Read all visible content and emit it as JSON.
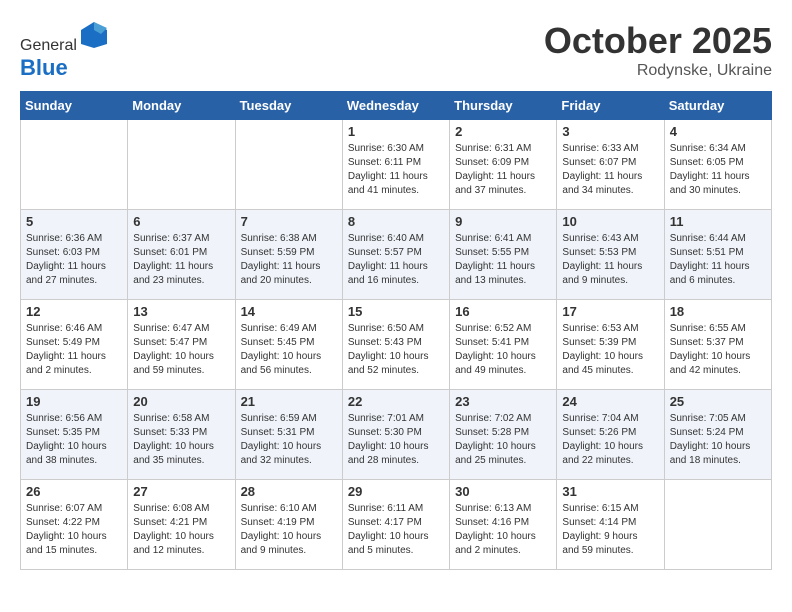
{
  "header": {
    "logo_general": "General",
    "logo_blue": "Blue",
    "month": "October 2025",
    "location": "Rodynske, Ukraine"
  },
  "weekdays": [
    "Sunday",
    "Monday",
    "Tuesday",
    "Wednesday",
    "Thursday",
    "Friday",
    "Saturday"
  ],
  "weeks": [
    [
      {
        "day": "",
        "info": ""
      },
      {
        "day": "",
        "info": ""
      },
      {
        "day": "",
        "info": ""
      },
      {
        "day": "1",
        "info": "Sunrise: 6:30 AM\nSunset: 6:11 PM\nDaylight: 11 hours\nand 41 minutes."
      },
      {
        "day": "2",
        "info": "Sunrise: 6:31 AM\nSunset: 6:09 PM\nDaylight: 11 hours\nand 37 minutes."
      },
      {
        "day": "3",
        "info": "Sunrise: 6:33 AM\nSunset: 6:07 PM\nDaylight: 11 hours\nand 34 minutes."
      },
      {
        "day": "4",
        "info": "Sunrise: 6:34 AM\nSunset: 6:05 PM\nDaylight: 11 hours\nand 30 minutes."
      }
    ],
    [
      {
        "day": "5",
        "info": "Sunrise: 6:36 AM\nSunset: 6:03 PM\nDaylight: 11 hours\nand 27 minutes."
      },
      {
        "day": "6",
        "info": "Sunrise: 6:37 AM\nSunset: 6:01 PM\nDaylight: 11 hours\nand 23 minutes."
      },
      {
        "day": "7",
        "info": "Sunrise: 6:38 AM\nSunset: 5:59 PM\nDaylight: 11 hours\nand 20 minutes."
      },
      {
        "day": "8",
        "info": "Sunrise: 6:40 AM\nSunset: 5:57 PM\nDaylight: 11 hours\nand 16 minutes."
      },
      {
        "day": "9",
        "info": "Sunrise: 6:41 AM\nSunset: 5:55 PM\nDaylight: 11 hours\nand 13 minutes."
      },
      {
        "day": "10",
        "info": "Sunrise: 6:43 AM\nSunset: 5:53 PM\nDaylight: 11 hours\nand 9 minutes."
      },
      {
        "day": "11",
        "info": "Sunrise: 6:44 AM\nSunset: 5:51 PM\nDaylight: 11 hours\nand 6 minutes."
      }
    ],
    [
      {
        "day": "12",
        "info": "Sunrise: 6:46 AM\nSunset: 5:49 PM\nDaylight: 11 hours\nand 2 minutes."
      },
      {
        "day": "13",
        "info": "Sunrise: 6:47 AM\nSunset: 5:47 PM\nDaylight: 10 hours\nand 59 minutes."
      },
      {
        "day": "14",
        "info": "Sunrise: 6:49 AM\nSunset: 5:45 PM\nDaylight: 10 hours\nand 56 minutes."
      },
      {
        "day": "15",
        "info": "Sunrise: 6:50 AM\nSunset: 5:43 PM\nDaylight: 10 hours\nand 52 minutes."
      },
      {
        "day": "16",
        "info": "Sunrise: 6:52 AM\nSunset: 5:41 PM\nDaylight: 10 hours\nand 49 minutes."
      },
      {
        "day": "17",
        "info": "Sunrise: 6:53 AM\nSunset: 5:39 PM\nDaylight: 10 hours\nand 45 minutes."
      },
      {
        "day": "18",
        "info": "Sunrise: 6:55 AM\nSunset: 5:37 PM\nDaylight: 10 hours\nand 42 minutes."
      }
    ],
    [
      {
        "day": "19",
        "info": "Sunrise: 6:56 AM\nSunset: 5:35 PM\nDaylight: 10 hours\nand 38 minutes."
      },
      {
        "day": "20",
        "info": "Sunrise: 6:58 AM\nSunset: 5:33 PM\nDaylight: 10 hours\nand 35 minutes."
      },
      {
        "day": "21",
        "info": "Sunrise: 6:59 AM\nSunset: 5:31 PM\nDaylight: 10 hours\nand 32 minutes."
      },
      {
        "day": "22",
        "info": "Sunrise: 7:01 AM\nSunset: 5:30 PM\nDaylight: 10 hours\nand 28 minutes."
      },
      {
        "day": "23",
        "info": "Sunrise: 7:02 AM\nSunset: 5:28 PM\nDaylight: 10 hours\nand 25 minutes."
      },
      {
        "day": "24",
        "info": "Sunrise: 7:04 AM\nSunset: 5:26 PM\nDaylight: 10 hours\nand 22 minutes."
      },
      {
        "day": "25",
        "info": "Sunrise: 7:05 AM\nSunset: 5:24 PM\nDaylight: 10 hours\nand 18 minutes."
      }
    ],
    [
      {
        "day": "26",
        "info": "Sunrise: 6:07 AM\nSunset: 4:22 PM\nDaylight: 10 hours\nand 15 minutes."
      },
      {
        "day": "27",
        "info": "Sunrise: 6:08 AM\nSunset: 4:21 PM\nDaylight: 10 hours\nand 12 minutes."
      },
      {
        "day": "28",
        "info": "Sunrise: 6:10 AM\nSunset: 4:19 PM\nDaylight: 10 hours\nand 9 minutes."
      },
      {
        "day": "29",
        "info": "Sunrise: 6:11 AM\nSunset: 4:17 PM\nDaylight: 10 hours\nand 5 minutes."
      },
      {
        "day": "30",
        "info": "Sunrise: 6:13 AM\nSunset: 4:16 PM\nDaylight: 10 hours\nand 2 minutes."
      },
      {
        "day": "31",
        "info": "Sunrise: 6:15 AM\nSunset: 4:14 PM\nDaylight: 9 hours\nand 59 minutes."
      },
      {
        "day": "",
        "info": ""
      }
    ]
  ]
}
